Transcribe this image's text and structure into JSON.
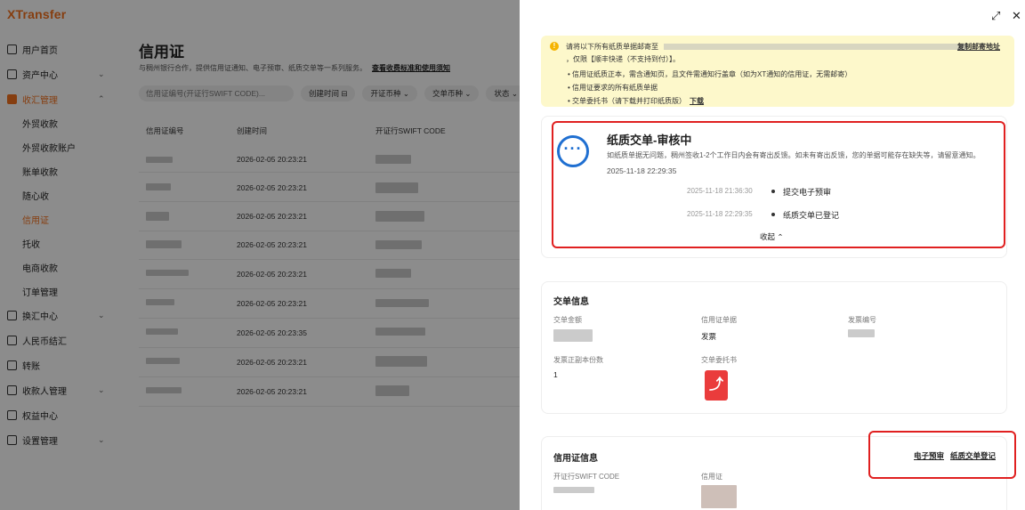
{
  "app": {
    "logo": "XTransfer"
  },
  "sidebar": {
    "items": [
      {
        "label": "用户首页",
        "icon": "home-icon"
      },
      {
        "label": "资产中心",
        "icon": "wallet-icon",
        "chevron": "⌄"
      },
      {
        "label": "收汇管理",
        "icon": "receive-icon",
        "chevron": "⌃"
      },
      {
        "label": "外贸收款"
      },
      {
        "label": "外贸收款账户"
      },
      {
        "label": "账单收款"
      },
      {
        "label": "随心收"
      },
      {
        "label": "信用证"
      },
      {
        "label": "托收"
      },
      {
        "label": "电商收款"
      },
      {
        "label": "订单管理"
      },
      {
        "label": "换汇中心",
        "icon": "exchange-icon",
        "chevron": "⌄"
      },
      {
        "label": "人民币结汇",
        "icon": "rmb-icon"
      },
      {
        "label": "转账",
        "icon": "transfer-icon"
      },
      {
        "label": "收款人管理",
        "icon": "payee-icon",
        "chevron": "⌄"
      },
      {
        "label": "权益中心",
        "icon": "benefit-icon"
      },
      {
        "label": "设置管理",
        "icon": "settings-icon",
        "chevron": "⌄"
      }
    ]
  },
  "main": {
    "title": "信用证",
    "description": "与稠州银行合作，提供信用证通知、电子预审、纸质交单等一系列服务。",
    "fee_link": "查看收费标准和使用须知",
    "search_placeholder": "信用证编号(开证行SWIFT CODE)...",
    "filters": [
      "创建时间 ⊟",
      "开证币种 ⌄",
      "交单币种 ⌄",
      "状态 ⌄"
    ],
    "columns": [
      "信用证编号",
      "创建时间",
      "开证行SWIFT CODE"
    ],
    "rows": [
      "2026-02-05 20:23:21",
      "2026-02-05 20:23:21",
      "2026-02-05 20:23:21",
      "2026-02-05 20:23:21",
      "2026-02-05 20:23:21",
      "2026-02-05 20:23:21",
      "2026-02-05 20:23:35",
      "2026-02-05 20:23:21",
      "2026-02-05 20:23:21"
    ]
  },
  "drawer": {
    "expand_icon": "⤢",
    "close_icon": "✕",
    "notice": {
      "line1": "请将以下所有纸质单据邮寄至",
      "line2": "，仅限【顺丰快递（不支持到付）】。",
      "copy_link": "复制邮寄地址",
      "bullets": [
        "信用证纸质正本，需含通知页，且文件需通知行盖章（如为XT通知的信用证，无需邮寄）",
        "信用证要求的所有纸质单据",
        "交单委托书（请下载并打印纸质版）"
      ],
      "download": "下载"
    },
    "status": {
      "title": "纸质交单-审核中",
      "description": "如纸质单据无问题，稠州签收1-2个工作日内会有寄出反馈。如未有寄出反馈，您的单据可能存在缺失等，请留意通知。",
      "time": "2025-11-18 22:29:35",
      "timeline": [
        {
          "time": "2025-11-18 21:36:30",
          "text": "提交电子预审"
        },
        {
          "time": "2025-11-18 22:29:35",
          "text": "纸质交单已登记"
        }
      ],
      "collapse": "收起 ⌃"
    },
    "presentation": {
      "title": "交单信息",
      "amount_label": "交单金额",
      "lc_doc_label": "信用证单据",
      "lc_doc_value": "发票",
      "invoice_no_label": "发票编号",
      "copies_label": "发票正副本份数",
      "copies_value": "1",
      "power_label": "交单委托书",
      "pdf_icon": "pdf-icon"
    },
    "lc_info": {
      "title": "信用证信息",
      "swift_label": "开证行SWIFT CODE",
      "lc_label": "信用证",
      "link_e": "电子预审",
      "link_p": "纸质交单登记"
    },
    "highlight_color": "#e02020"
  }
}
